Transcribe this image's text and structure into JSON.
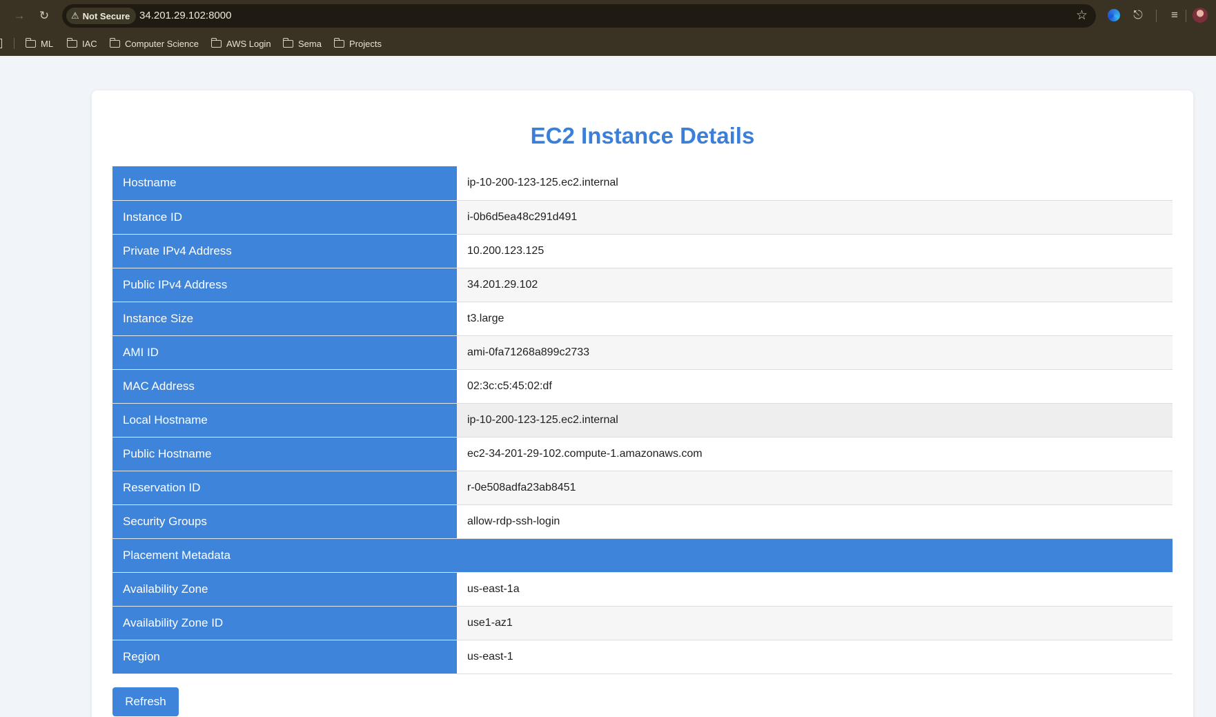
{
  "browser": {
    "security_label": "Not Secure",
    "url": "34.201.29.102:8000",
    "bookmarks": [
      {
        "label": "ML"
      },
      {
        "label": "IAC"
      },
      {
        "label": "Computer Science"
      },
      {
        "label": "AWS Login"
      },
      {
        "label": "Sema"
      },
      {
        "label": "Projects"
      }
    ]
  },
  "page": {
    "title": "EC2 Instance Details",
    "rows": [
      {
        "label": "Hostname",
        "value": "ip-10-200-123-125.ec2.internal"
      },
      {
        "label": "Instance ID",
        "value": "i-0b6d5ea48c291d491"
      },
      {
        "label": "Private IPv4 Address",
        "value": "10.200.123.125"
      },
      {
        "label": "Public IPv4 Address",
        "value": "34.201.29.102"
      },
      {
        "label": "Instance Size",
        "value": "t3.large"
      },
      {
        "label": "AMI ID",
        "value": "ami-0fa71268a899c2733"
      },
      {
        "label": "MAC Address",
        "value": "02:3c:c5:45:02:df"
      },
      {
        "label": "Local Hostname",
        "value": "ip-10-200-123-125.ec2.internal"
      },
      {
        "label": "Public Hostname",
        "value": "ec2-34-201-29-102.compute-1.amazonaws.com"
      },
      {
        "label": "Reservation ID",
        "value": "r-0e508adfa23ab8451"
      },
      {
        "label": "Security Groups",
        "value": "allow-rdp-ssh-login"
      }
    ],
    "section_heading": "Placement Metadata",
    "placement_rows": [
      {
        "label": "Availability Zone",
        "value": "us-east-1a"
      },
      {
        "label": "Availability Zone ID",
        "value": "use1-az1"
      },
      {
        "label": "Region",
        "value": "us-east-1"
      }
    ],
    "refresh_label": "Refresh"
  },
  "colors": {
    "accent": "#3d84da",
    "title": "#3b7fd9",
    "chrome": "#3a3323"
  }
}
